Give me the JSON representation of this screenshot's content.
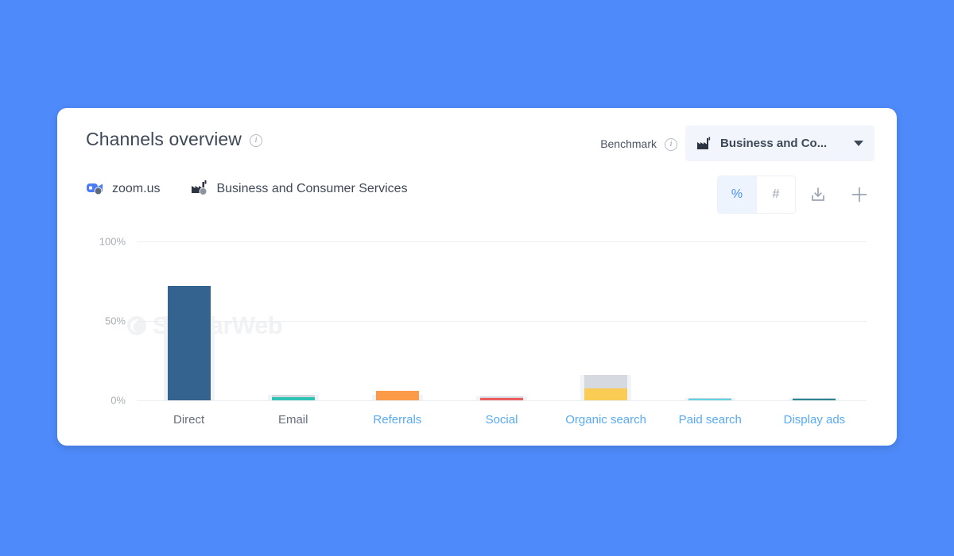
{
  "page": {
    "background_color": "#4e8af9"
  },
  "card": {
    "header": {
      "title": "Channels overview",
      "info_icon": "info-icon",
      "benchmark_label": "Benchmark",
      "benchmark_info_icon": "info-icon",
      "benchmark_value": "Business and Co...",
      "benchmark_icon": "industry-icon",
      "caret_icon": "chevron-down-icon"
    },
    "legend": [
      {
        "label": "zoom.us",
        "icon": "zoom-favicon"
      },
      {
        "label": "Business and Consumer Services",
        "icon": "industry-icon"
      }
    ],
    "tools": {
      "percent_label": "%",
      "number_label": "#",
      "percent_active": true,
      "download_icon": "download-icon",
      "add_icon": "plus-icon"
    },
    "watermark": {
      "text": "SimilarWeb",
      "logo_icon": "similarweb-logo-icon"
    }
  },
  "chart_data": {
    "type": "bar",
    "title": "Channels overview",
    "xlabel": "",
    "ylabel": "",
    "ylim": [
      0,
      100
    ],
    "yticks": [
      0,
      50,
      100
    ],
    "ytick_labels": [
      "0%",
      "50%",
      "100%"
    ],
    "grid": true,
    "legend_position": "top-left",
    "categories": [
      "Direct",
      "Email",
      "Referrals",
      "Social",
      "Organic search",
      "Paid search",
      "Display ads"
    ],
    "category_is_link": [
      false,
      false,
      true,
      true,
      true,
      true,
      true
    ],
    "series": [
      {
        "name": "zoom.us",
        "values": [
          72,
          2,
          6,
          1.5,
          7.5,
          1,
          1
        ],
        "colors": [
          "#35638f",
          "#2ec3b4",
          "#fb9a48",
          "#ee5d5d",
          "#fbcc54",
          "#5fd4e0",
          "#2c8691"
        ]
      },
      {
        "name": "Business and Consumer Services",
        "values": [
          53,
          3.5,
          3.5,
          2.5,
          16,
          1.5,
          1.5
        ],
        "color": "#d6d9e0"
      }
    ]
  }
}
